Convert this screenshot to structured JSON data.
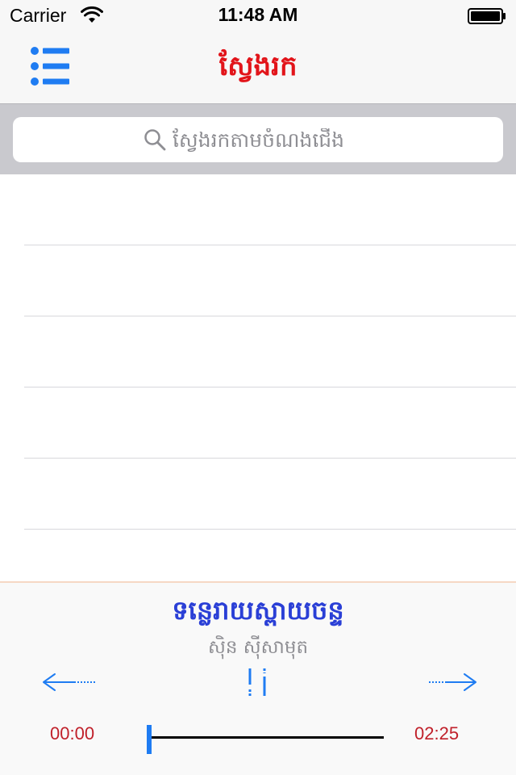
{
  "status_bar": {
    "carrier": "Carrier",
    "time": "11:48 AM",
    "icons": [
      "wifi-icon",
      "battery-icon"
    ]
  },
  "nav": {
    "title": "ស្វែងរក",
    "menu_icon": "list-icon",
    "title_color": "#e2141a",
    "accent_color": "#1f7cf2"
  },
  "search": {
    "placeholder": "ស្វែងរកតាមចំណងជើង",
    "value": "",
    "icon": "search-icon"
  },
  "list": {
    "rows": [
      "",
      "",
      "",
      "",
      ""
    ]
  },
  "player": {
    "song_title": "ទន្លេរាយស្ពាយចន្ទ",
    "artist": "ស៊ិន ស៊ីសាមុត",
    "current_time": "00:00",
    "total_time": "02:25",
    "progress": 0,
    "icons": [
      "prev-arrow-icon",
      "pause-icon",
      "next-arrow-icon"
    ],
    "title_color": "#2a3fd6",
    "time_color": "#c0202a"
  }
}
